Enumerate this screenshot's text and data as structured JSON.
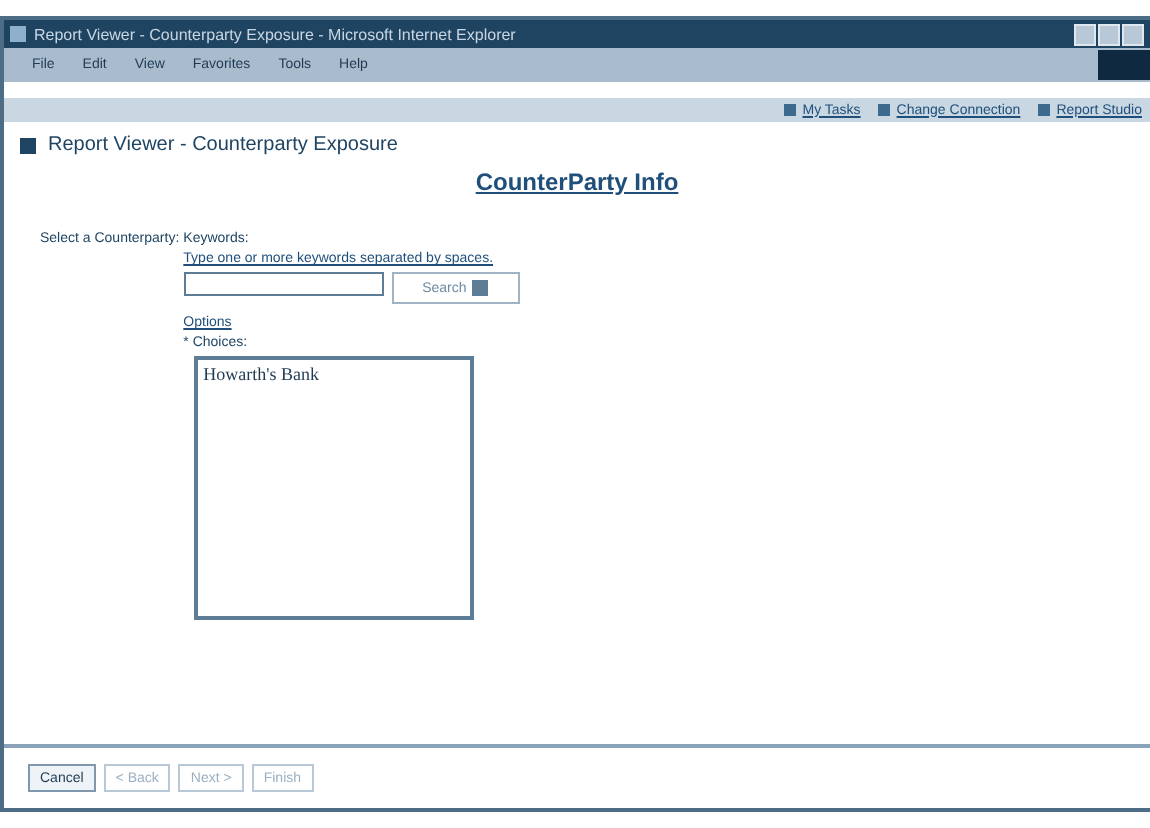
{
  "window": {
    "title": "Report Viewer - Counterparty Exposure - Microsoft Internet Explorer"
  },
  "menu": [
    "File",
    "Edit",
    "View",
    "Favorites",
    "Tools",
    "Help"
  ],
  "top_links": [
    "My Tasks",
    "Change Connection",
    "Report Studio"
  ],
  "page_title": "Report Viewer - Counterparty Exposure",
  "section_title": "CounterParty Info",
  "prompt": {
    "label": "Select a Counterparty:",
    "keywords_label": "Keywords:",
    "hint": "Type one or more keywords separated by spaces.",
    "search_button": "Search",
    "options_link": "Options",
    "choices_label": "* Choices:",
    "choices": [
      {
        "label": "Howarth's Bank",
        "selected": false
      }
    ]
  },
  "buttons": [
    {
      "label": "Cancel",
      "disabled": false
    },
    {
      "label": "< Back",
      "disabled": true
    },
    {
      "label": "Next >",
      "disabled": true
    },
    {
      "label": "Finish",
      "disabled": true
    }
  ]
}
